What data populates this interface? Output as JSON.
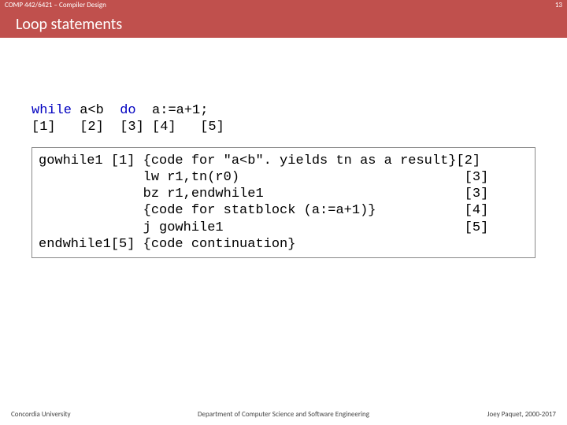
{
  "header": {
    "course": "COMP 442/6421 – Compiler Design",
    "page_no": "13"
  },
  "title": "Loop statements",
  "syntax": {
    "line1_a": "while",
    "line1_b": " a<b  ",
    "line1_c": "do",
    "line1_d": "  a:=a+1;",
    "line2": "[1]   [2]  [3] [4]   [5]"
  },
  "code": {
    "l1": "gowhile1 [1] {code for \"a<b\". yields tn as a result}[2]",
    "l2": "             lw r1,tn(r0)                            [3]",
    "l3": "             bz r1,endwhile1                         [3]",
    "l4": "             {code for statblock (a:=a+1)}           [4]",
    "l5": "             j gowhile1                              [5]",
    "l6": "endwhile1[5] {code continuation}"
  },
  "footer": {
    "left": "Concordia University",
    "center": "Department of Computer Science and Software Engineering",
    "right": "Joey Paquet, 2000-2017"
  }
}
